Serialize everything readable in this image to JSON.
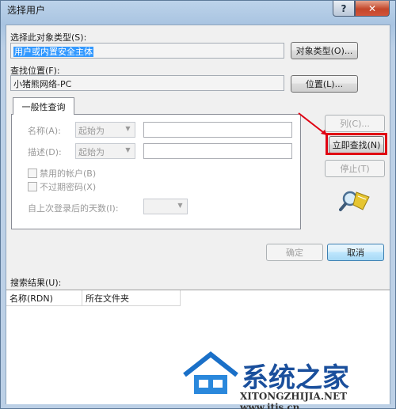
{
  "window": {
    "title": "选择用户",
    "help_label": "?",
    "close_label": "✕"
  },
  "object_type": {
    "label": "选择此对象类型(S):",
    "value": "用户或内置安全主体",
    "button": "对象类型(O)..."
  },
  "location": {
    "label": "查找位置(F):",
    "value": "小猪熊网络-PC",
    "button": "位置(L)..."
  },
  "tab": {
    "label": "一般性查询"
  },
  "query": {
    "name_label": "名称(A):",
    "name_mode": "起始为",
    "desc_label": "描述(D):",
    "desc_mode": "起始为",
    "disabled_accounts": "禁用的帐户(B)",
    "no_expire_pwd": "不过期密码(X)",
    "days_since_login": "自上次登录后的天数(I):"
  },
  "buttons": {
    "columns": "列(C)...",
    "find_now": "立即查找(N)",
    "stop": "停止(T)",
    "ok": "确定",
    "cancel": "取消"
  },
  "results": {
    "label": "搜索结果(U):",
    "columns": [
      "名称(RDN)",
      "所在文件夹"
    ]
  },
  "watermark": {
    "brand": "系统之家",
    "url": "XITONGZHIJIA.NET  www.itjs.cn"
  },
  "colors": {
    "highlight": "#e00012",
    "selection": "#3399ff",
    "brand_blue": "#1a4f9c"
  }
}
